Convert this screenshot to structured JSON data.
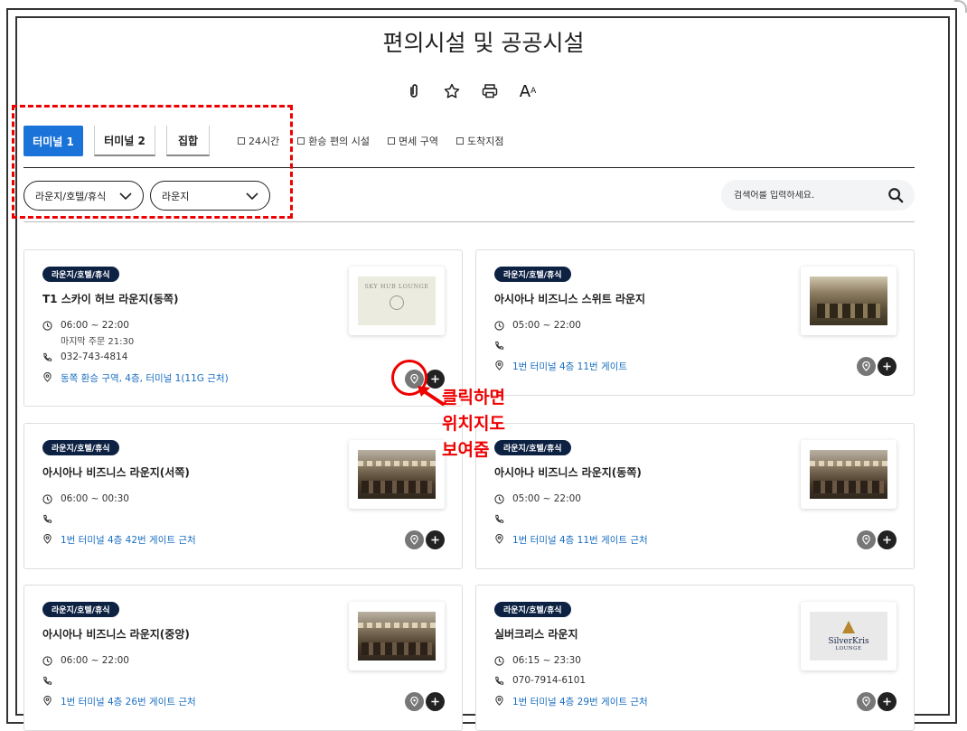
{
  "page": {
    "title": "편의시설 및 공공시설"
  },
  "tools": [
    {
      "name": "clip-icon",
      "label": ""
    },
    {
      "name": "star-icon",
      "label": ""
    },
    {
      "name": "print-icon",
      "label": ""
    }
  ],
  "font_tool": {
    "big": "A",
    "small": "A"
  },
  "tabs": [
    {
      "label": "터미널 1",
      "active": true
    },
    {
      "label": "터미널 2",
      "active": false
    },
    {
      "label": "집합",
      "active": false
    }
  ],
  "filters": [
    {
      "label": "24시간"
    },
    {
      "label": "환승 편의 시설"
    },
    {
      "label": "면세 구역"
    },
    {
      "label": "도착지점"
    }
  ],
  "selects": [
    {
      "value": "라운지/호텔/휴식"
    },
    {
      "value": "라운지"
    }
  ],
  "search": {
    "placeholder": "검색어를 입력하세요."
  },
  "cards": [
    {
      "badge": "라운지/호텔/휴식",
      "name": "T1 스카이 허브 라운지(동쪽)",
      "hours": "06:00 ~ 22:00",
      "hours_note": "마지막 주문 21:30",
      "phone": "032-743-4814",
      "location": "동쪽 환승 구역, 4층, 터미널 1(11G 근처)",
      "image": "sky-hub-lounge-logo",
      "logo_text": "SKY HUB LOUNGE"
    },
    {
      "badge": "라운지/호텔/휴식",
      "name": "아시아나 비즈니스 스위트 라운지",
      "hours": "05:00 ~ 22:00",
      "phone": "",
      "location": "1번 터미널 4층 11번 게이트",
      "image": "suite-lounge-photo"
    },
    {
      "badge": "라운지/호텔/휴식",
      "name": "아시아나 비즈니스 라운지(서쪽)",
      "hours": "06:00 ~ 00:30",
      "phone": "",
      "location": "1번 터미널 4층 42번 게이트 근처",
      "image": "lounge-photo"
    },
    {
      "badge": "라운지/호텔/휴식",
      "name": "아시아나 비즈니스 라운지(동쪽)",
      "hours": "05:00 ~ 22:00",
      "phone": "",
      "location": "1번 터미널 4층 11번 게이트 근처",
      "image": "lounge-photo"
    },
    {
      "badge": "라운지/호텔/휴식",
      "name": "아시아나 비즈니스 라운지(중앙)",
      "hours": "06:00 ~ 22:00",
      "phone": "",
      "location": "1번 터미널 4층 26번 게이트 근처",
      "image": "lounge-photo"
    },
    {
      "badge": "라운지/호텔/휴식",
      "name": "실버크리스 라운지",
      "hours": "06:15 ~ 23:30",
      "phone": "070-7914-6101",
      "location": "1번 터미널 4층 29번 게이트 근처",
      "image": "silverkris-lounge-logo",
      "logo_text": "SilverKris",
      "logo_sub": "LOUNGE"
    }
  ],
  "annotation": {
    "lines": [
      "클릭하면",
      "위치지도",
      "보여줌"
    ],
    "color": "#e00000"
  },
  "colors": {
    "accent": "#1a73d9",
    "badge": "#0d2143",
    "link": "#1a6fc2"
  }
}
